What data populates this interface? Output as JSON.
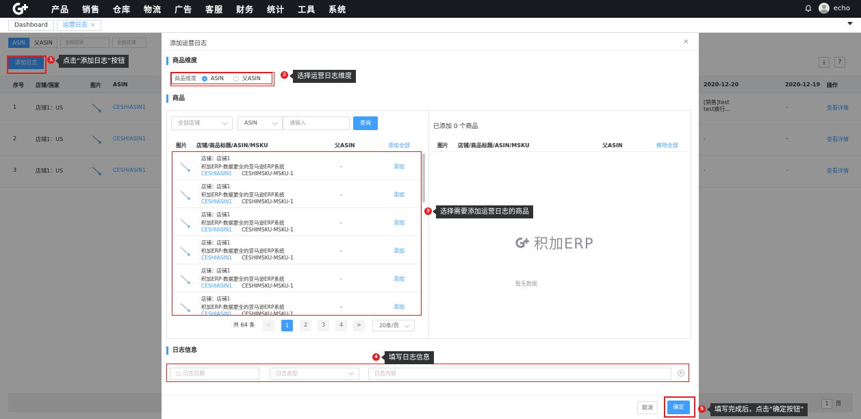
{
  "topnav": {
    "items": [
      "产品",
      "销售",
      "仓库",
      "物流",
      "广告",
      "客服",
      "财务",
      "统计",
      "工具",
      "系统"
    ],
    "username": "echo"
  },
  "tabs": {
    "dashboard": "Dashboard",
    "active": "运营日志",
    "close": "×"
  },
  "background": {
    "filters": [
      "ASIN",
      "父ASIN",
      "全部国家",
      "全部店铺"
    ],
    "add_button": "添加日志",
    "headers": [
      "序号",
      "店铺/国家",
      "图片",
      "ASIN"
    ],
    "date_cols": [
      "2020-12-20",
      "2020-12-19"
    ],
    "op_header": "操作",
    "rows": [
      {
        "no": "1",
        "store": "店铺1：US",
        "asin": "CESHIASIN1",
        "log1": "[销售]test",
        "log2": "test换行...",
        "d2": "-",
        "op": "查看详情"
      },
      {
        "no": "2",
        "store": "店铺1：US",
        "asin": "CESHIASIN1",
        "log1": "-",
        "log2": "",
        "d2": "-",
        "op": "查看详情"
      },
      {
        "no": "3",
        "store": "店铺1：US",
        "asin": "CESHIASIN1",
        "log1": "-",
        "log2": "",
        "d2": "-",
        "op": "查看详情"
      }
    ],
    "pager_total": "1",
    "pager_unit": "页"
  },
  "modal": {
    "title": "添加运营日志",
    "close": "×",
    "section_dimension": "商品维度",
    "dimension_label": "商品维度",
    "radio_asin": "ASIN",
    "radio_parent": "父ASIN",
    "section_goods": "商品",
    "store_select": "全部店铺",
    "field_select": "ASIN",
    "search_placeholder": "请输入",
    "query_button": "查询",
    "added_count": "已添加 0 个商品",
    "left_headers": {
      "image": "图片",
      "title": "店铺/商品标题/ASIN/MSKU",
      "parent": "父ASIN",
      "add_all": "添加全部"
    },
    "right_headers": {
      "image": "图片",
      "title": "店铺/商品标题/ASIN/MSKU",
      "parent": "父ASIN",
      "remove_all": "移除全部"
    },
    "items": [
      {
        "store": "店铺：店铺1",
        "title": "积加ERP-数据更全的亚马逊ERP系统",
        "asin": "CESHIASIN1",
        "sku": "CESHIMSKU-MSKU-1",
        "parent": "-",
        "add": "添加"
      },
      {
        "store": "店铺：店铺1",
        "title": "积加ERP-数据更全的亚马逊ERP系统",
        "asin": "CESHIASIN1",
        "sku": "CESHIMSKU-MSKU-1",
        "parent": "-",
        "add": "添加"
      },
      {
        "store": "店铺：店铺1",
        "title": "积加ERP-数据更全的亚马逊ERP系统",
        "asin": "CESHIASIN1",
        "sku": "CESHIMSKU-MSKU-1",
        "parent": "-",
        "add": "添加"
      },
      {
        "store": "店铺：店铺1",
        "title": "积加ERP-数据更全的亚马逊ERP系统",
        "asin": "CESHIASIN1",
        "sku": "CESHIMSKU-MSKU-1",
        "parent": "-",
        "add": "添加"
      },
      {
        "store": "店铺：店铺1",
        "title": "积加ERP-数据更全的亚马逊ERP系统",
        "asin": "CESHIASIN1",
        "sku": "CESHIMSKU-MSKU-1",
        "parent": "-",
        "add": "添加"
      },
      {
        "store": "店铺：店铺1",
        "title": "积加ERP-数据更全的亚马逊ERP系统",
        "asin": "CESHIASIN1",
        "sku": "CESHIMSKU-MSKU-1",
        "parent": "-",
        "add": "添加"
      }
    ],
    "pagination": {
      "total": "共 64 条",
      "prev": "<",
      "pages": [
        "1",
        "2",
        "3",
        "4"
      ],
      "next": ">",
      "size": "20条/页"
    },
    "empty_brand": "积加ERP",
    "empty_text": "暂无数据",
    "section_log": "日志信息",
    "log_date_placeholder": "日志日期",
    "log_type_placeholder": "日志类型",
    "log_content_placeholder": "日志内容",
    "cancel": "取消",
    "confirm": "确定"
  },
  "annotations": [
    {
      "num": "1",
      "text": "点击“添加日志”按钮"
    },
    {
      "num": "2",
      "text": "选择运营日志维度"
    },
    {
      "num": "3",
      "text": "选择需要添加运营日志的商品"
    },
    {
      "num": "4",
      "text": "填写日志信息"
    },
    {
      "num": "5",
      "text": "填写完成后，点击“确定按钮”"
    }
  ],
  "colors": {
    "primary": "#409eff",
    "annotation": "#e02020",
    "nav": "#181a1f"
  }
}
